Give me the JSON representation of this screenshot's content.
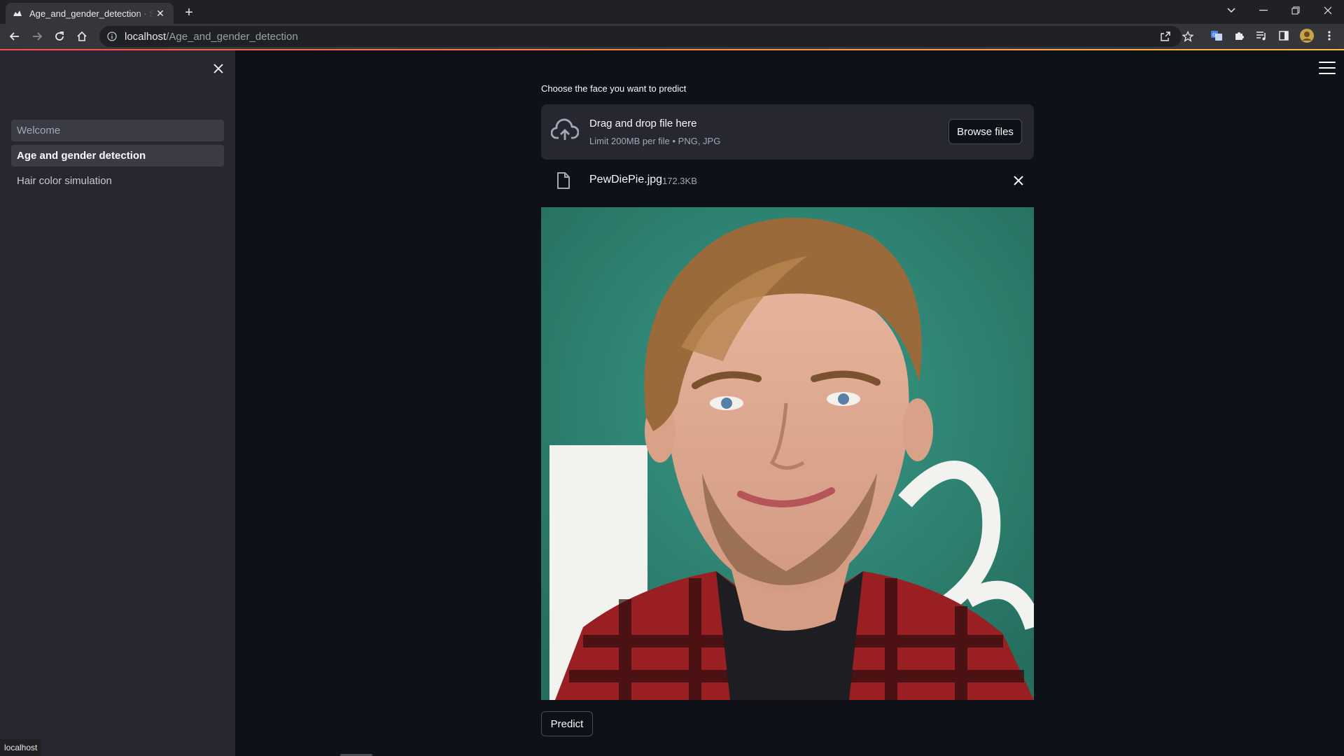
{
  "browser": {
    "tab_title": "Age_and_gender_detection · Streamlit",
    "url_host": "localhost",
    "url_path": "/Age_and_gender_detection",
    "status_text": "localhost"
  },
  "sidebar": {
    "items": [
      {
        "label": "Welcome",
        "state": "hover"
      },
      {
        "label": "Age and gender detection",
        "state": "active"
      },
      {
        "label": "Hair color simulation",
        "state": "default"
      }
    ]
  },
  "uploader": {
    "label": "Choose the face you want to predict",
    "dropzone_title": "Drag and drop file here",
    "dropzone_subtitle": "Limit 200MB per file • PNG, JPG",
    "browse_label": "Browse files",
    "file_name": "PewDiePie.jpg",
    "file_size": "172.3KB"
  },
  "image": {
    "description": "uploaded face photo",
    "background_color": "#2f8a78"
  },
  "actions": {
    "predict_label": "Predict"
  },
  "colors": {
    "app_bg": "#0e1117",
    "sidebar_bg": "#262730",
    "text": "#fafafa",
    "accent_start": "#ff4b4b",
    "accent_end": "#ffbd45"
  }
}
